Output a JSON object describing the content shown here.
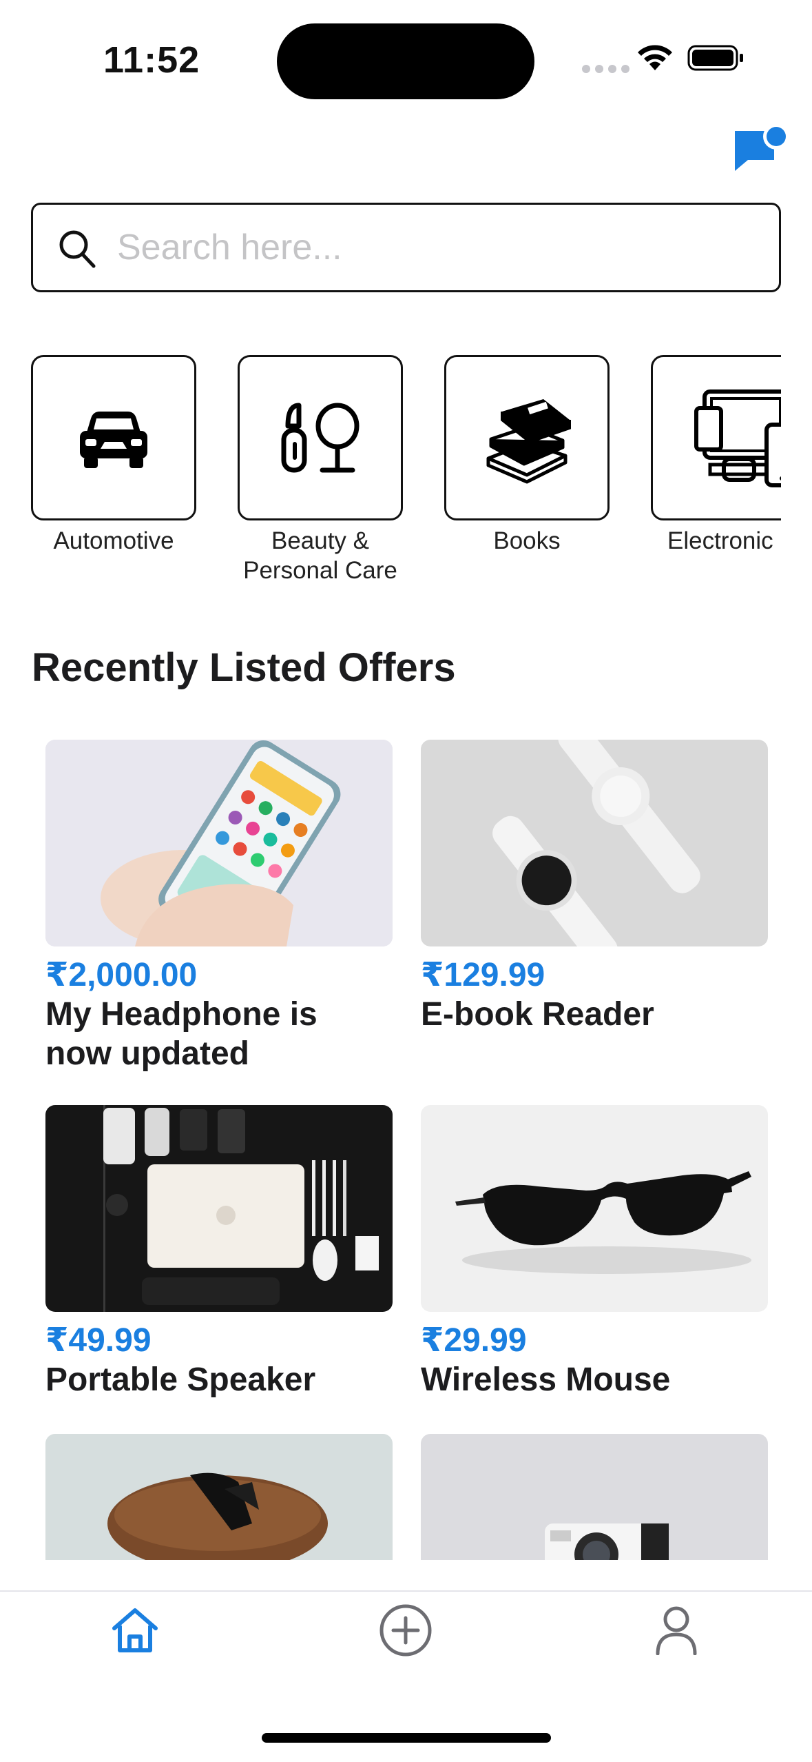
{
  "status_bar": {
    "time": "11:52"
  },
  "search": {
    "placeholder": "Search here..."
  },
  "categories": [
    {
      "label": "Automotive",
      "icon": "car-icon"
    },
    {
      "label": "Beauty &\nPersonal Care",
      "icon": "lipstick-mirror-icon"
    },
    {
      "label": "Books",
      "icon": "books-icon"
    },
    {
      "label": "Electronic",
      "icon": "devices-icon"
    }
  ],
  "section": {
    "title": "Recently Listed Offers"
  },
  "offers": [
    {
      "price": "₹2,000.00",
      "title": "My Headphone is now updated",
      "image": "phone-in-hand-photo"
    },
    {
      "price": "₹129.99",
      "title": "E-book Reader",
      "image": "smartwatch-photo"
    },
    {
      "price": "₹49.99",
      "title": "Portable Speaker",
      "image": "laptop-flatlay-photo"
    },
    {
      "price": "₹29.99",
      "title": "Wireless Mouse",
      "image": "sunglasses-photo"
    },
    {
      "price": "",
      "title": "",
      "image": "sunglasses-case-photo"
    },
    {
      "price": "",
      "title": "",
      "image": "instant-camera-photo"
    }
  ],
  "tabs": [
    {
      "name": "home",
      "icon": "home-icon",
      "active": true
    },
    {
      "name": "add",
      "icon": "plus-circle-icon",
      "active": false
    },
    {
      "name": "profile",
      "icon": "person-icon",
      "active": false
    }
  ],
  "colors": {
    "accent": "#1a7fe0",
    "text": "#1c1c1e",
    "inactive": "#6d6d72"
  }
}
